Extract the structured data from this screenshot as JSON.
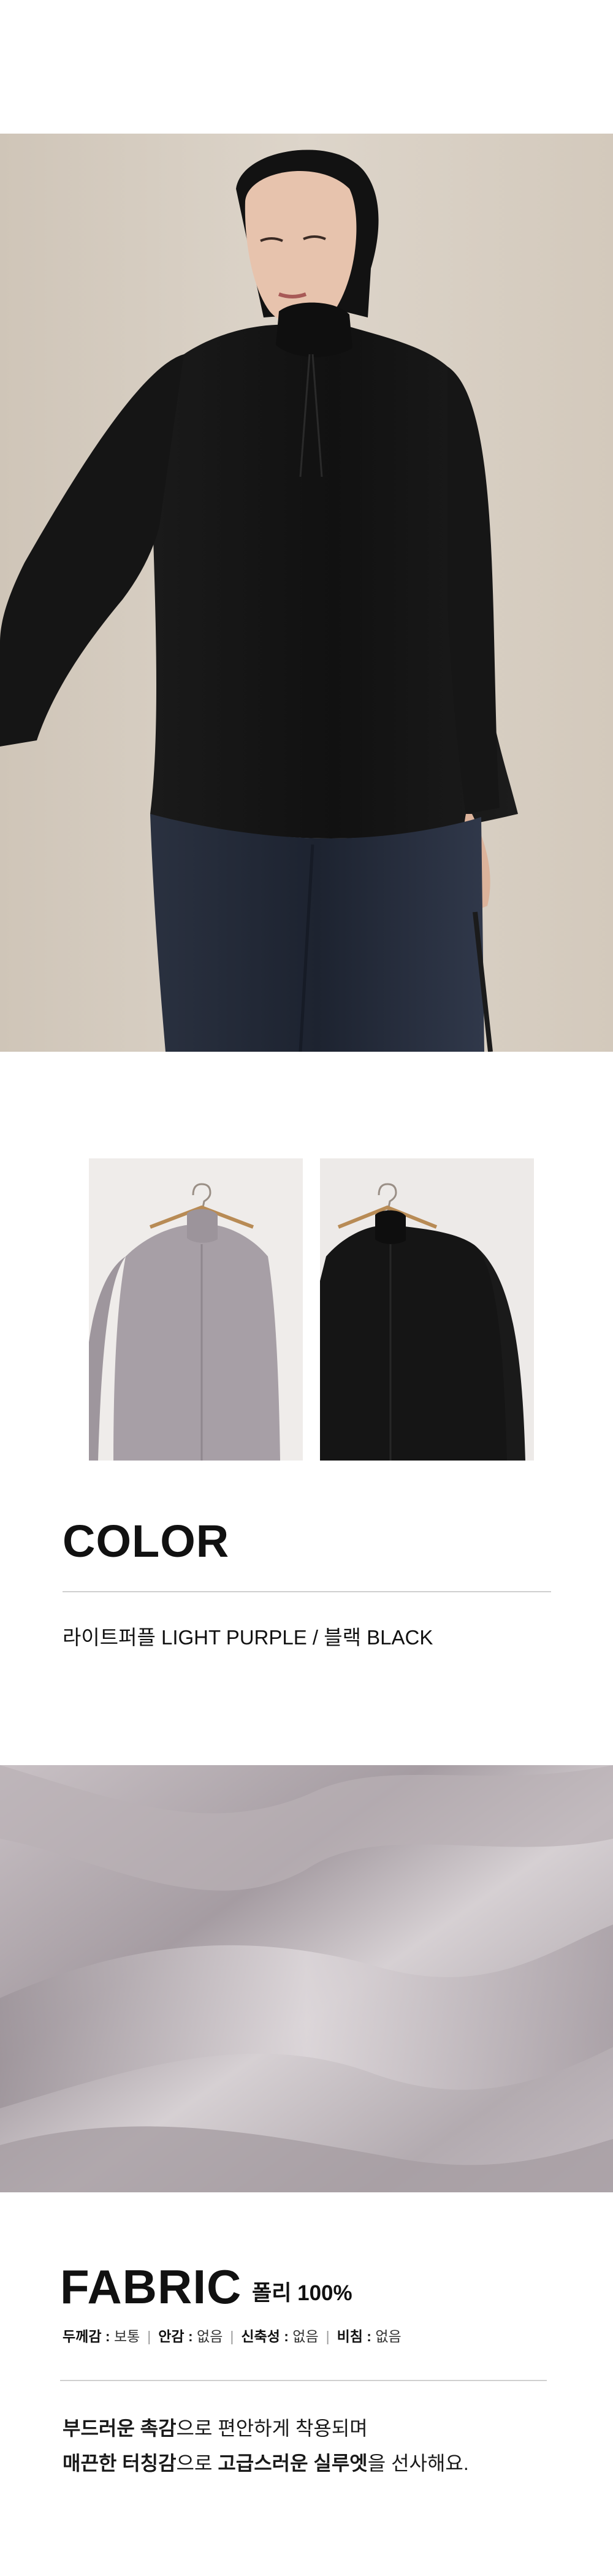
{
  "color_section": {
    "title": "COLOR",
    "description": "라이트퍼플 LIGHT PURPLE / 블랙 BLACK",
    "swatches": [
      {
        "name": "light-purple",
        "color": "#a79fa6"
      },
      {
        "name": "black",
        "color": "#141414"
      }
    ]
  },
  "fabric_section": {
    "title": "FABRIC",
    "composition": "폴리 100%",
    "specs": [
      {
        "label": "두께감",
        "value": "보통"
      },
      {
        "label": "안감",
        "value": "없음"
      },
      {
        "label": "신축성",
        "value": "없음"
      },
      {
        "label": "비침",
        "value": "없음"
      }
    ],
    "copy": {
      "line1_bold": "부드러운 촉감",
      "line1_rest": "으로 편안하게 착용되며",
      "line2_bold": "매끈한 터칭감",
      "line2_mid": "으로 ",
      "line2_bold2": "고급스러운 실루엣",
      "line2_rest": "을 선사해요."
    },
    "fabric_color": "#bdb5ba"
  }
}
